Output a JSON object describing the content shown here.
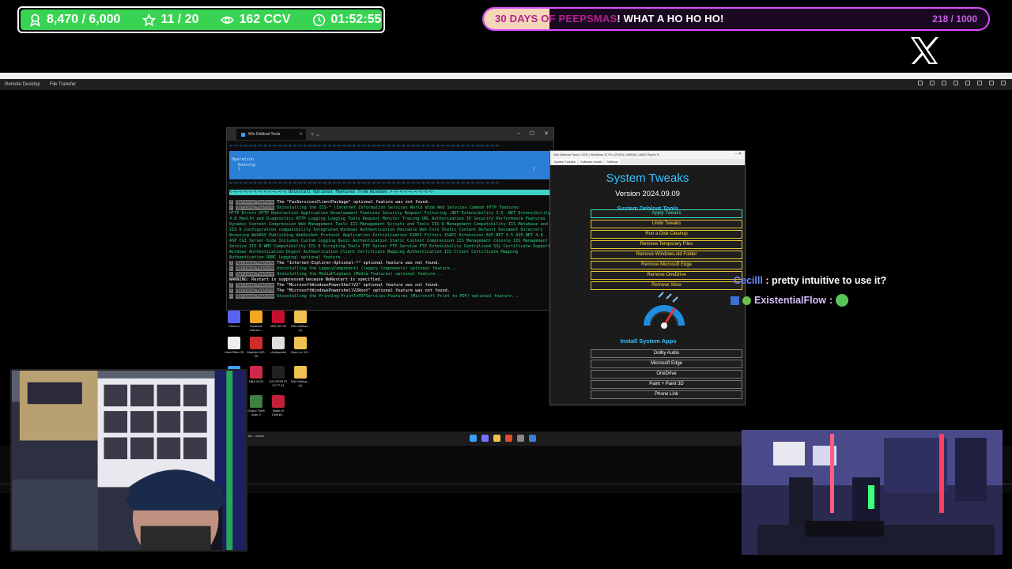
{
  "overlay": {
    "stats": {
      "followers": "8,470 / 6,000",
      "subs": "11 / 20",
      "viewers": "162 CCV",
      "uptime": "01:52:55"
    },
    "goal": {
      "title_part1": "30 DAYS OF PEEPSMAS",
      "title_part2": "! WHAT A HO HO HO!",
      "count": "218 / 1000",
      "progress": 0.218
    }
  },
  "remote_desktop": {
    "menu": [
      "Remote Desktop",
      "File Transfer"
    ]
  },
  "terminal": {
    "tab_title": "Win Debloat Tools",
    "dashes": "<-<-<-<-<-<-<-<-<-<-<-<-<-<-<-<-<-<-<-<-<-<-<-<-<-<-<-<-<-<-<-<-<-<-<-<-<-<-<-<-<-<-<-<-<-<-<-<-<-<-<-<-<-<-<-",
    "operation_label": "Operation",
    "operation_status": "Running",
    "operation_bracket_l": "[",
    "operation_bracket_r": "]",
    "section_title": "<-<-<-<-<-<-<-<-<-<-<-< Uninstall Optional Features from Windows >-<-<-<-<-<-<-<-<-",
    "lines": [
      {
        "tag": "?",
        "tag2": "OptionalFeature",
        "text": "The \"FaxServicesClientPackage\" optional feature was not found.",
        "white": true
      },
      {
        "tag": "-",
        "tag2": "OptionalFeature",
        "text": "Uninstalling the IIS-* (Internet Information Services World Wide Web Services Common HTTP Features",
        "white": false
      }
    ],
    "paragraph": "HTTP Errors HTTP Redirection Application Development Features Security Request Filtering .NET Extensibility 3.5 .NET Extensibility 4.8 Health and Diagnostics HTTP Logging Logging Tools Request Monitor Tracing URL Authorization IP Security Performance Features Dynamic Content Compression Web Management Tools IIS Management Scripts and Tools IIS 6 Management Compatibility IIS Metabase and IIS 6 configuration compatibility Integrated Windows Authentication Hostable Web Core Static Content Default Document Directory Browsing WebDAV Publishing WebSocket Protocol Application Initialization ISAPI Filters ISAPI Extensions ASP.NET 3.5 ASP.NET 4.8 ASP CGI Server-Side Includes Custom Logging Basic Authentication Static Content Compression IIS Management Console IIS Management Service IIS 6 WMI Compatibility IIS 6 Scripting Tools FTP Server FTP Service FTP Extensibility Centralized SSL Certificate Support Windows Authentication Digest Authentication Client Certificate Mapping Authentication IIS Client Certificate Mapping Authentication ODBC Logging) optional feature...",
    "lines2": [
      {
        "tag": "?",
        "tag2": "OptionalFeature",
        "text": "The \"Internet-Explorer-Optional-*\" optional feature was not found.",
        "white": true
      },
      {
        "tag": "-",
        "tag2": "OptionalFeature",
        "text": "Uninstalling the LegacyComponents (Legacy Components) optional feature...",
        "white": false
      },
      {
        "tag": "-",
        "tag2": "OptionalFeature",
        "text": "Uninstalling the MediaPlayback (Media Features) optional feature...",
        "white": false
      }
    ],
    "warning": "WARNING: Restart is suppressed because NoRestart is specified.",
    "lines3": [
      {
        "tag": "?",
        "tag2": "OptionalFeature",
        "text": "The \"MicrosoftWindowsPowerShellV2\" optional feature was not found.",
        "white": true
      },
      {
        "tag": "?",
        "tag2": "OptionalFeature",
        "text": "The \"MicrosoftWindowsPowershellV2Root\" optional feature was not found.",
        "white": true
      },
      {
        "tag": "-",
        "tag2": "OptionalFeature",
        "text": "Uninstalling the Printing-PrintToPDFServices-Features (Microsoft Print to PDF) optional feature...",
        "white": false
      }
    ]
  },
  "tweaks": {
    "window_title": "Win Debloat Tools | SSD | Windows 11 Pro (23H2) | AMD64 | AMD Ryzen 9...",
    "tabs": [
      "System Tweaks",
      "Software Install",
      "Settings"
    ],
    "heading": "System Tweaks",
    "version": "Version 2024.09.09",
    "subheading": "System Debloat Tools",
    "buttons": [
      "Apply Tweaks",
      "Undo Tweaks",
      "Run a Disk Cleanup",
      "Remove Temporary Files",
      "Remove Windows.old Folder",
      "Remove Microsoft Edge",
      "Remove OneDrive",
      "Remove Xbox"
    ],
    "install_heading": "Install System Apps",
    "apps": [
      "Dolby Audio",
      "Microsoft Edge",
      "OneDrive",
      "Paint + Paint 3D",
      "Phone Link"
    ]
  },
  "desktop_icons": [
    {
      "label": "Discord",
      "color": "#5865f2"
    },
    {
      "label": "Rockstar Games...",
      "color": "#f5a623"
    },
    {
      "label": "MSI GR 95",
      "color": "#c8102e"
    },
    {
      "label": "Win Debloa... (1)",
      "color": "#f0c050"
    },
    {
      "label": "LibreOffice 25",
      "color": "#eee"
    },
    {
      "label": "Madden NFL 25",
      "color": "#d02b2b"
    },
    {
      "label": "Undisputed",
      "color": "#ddd"
    },
    {
      "label": "Drum n> 10...",
      "color": "#f0c050"
    },
    {
      "label": "",
      "color": "#3fa0ff"
    },
    {
      "label": "NBA 2K24",
      "color": "#d0284a"
    },
    {
      "label": "EA SPORTS FC™ 24",
      "color": "#222"
    },
    {
      "label": "Win Debloa... (1)",
      "color": "#f0c050"
    },
    {
      "label": "Grand Theft Auto V",
      "color": "#3f7f3f"
    },
    {
      "label": "Mafia III Definiti...",
      "color": "#c41e3a"
    }
  ],
  "taskbar": {
    "weather": "Bc... weath"
  },
  "chat": [
    {
      "user": "Cecilll",
      "message": ": pretty intuitive to use it?"
    },
    {
      "user": "ExistentialFlow",
      "message": ":"
    }
  ],
  "colors": {
    "stats_green": "#39d353",
    "goal_border": "#d94dff",
    "terminal_green": "#33d17a",
    "tweaks_accent": "#35c3ff",
    "tweaks_button_border": "#e8c53a"
  }
}
